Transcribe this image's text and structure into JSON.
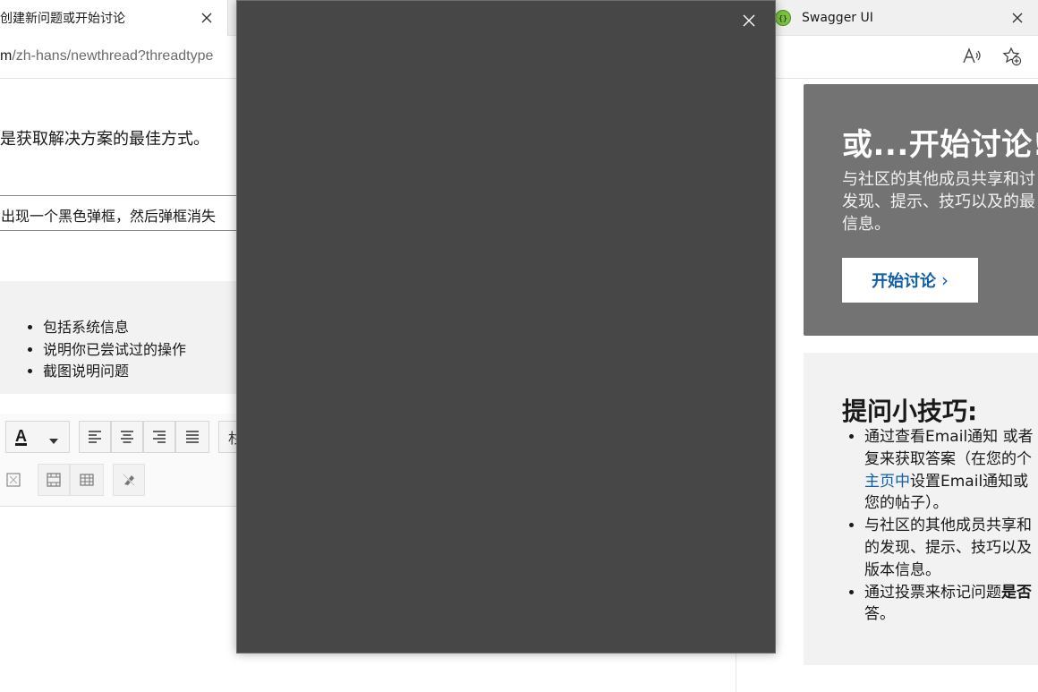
{
  "browser": {
    "active_tab_title": "创建新问题或开始讨论",
    "other_tab_title": "Swagger UI",
    "url_host": "m",
    "url_path": "/zh-hans/newthread?threadtype"
  },
  "page": {
    "intro_text": "是获取解决方案的最佳方式。",
    "title_input_value": "出现一个黑色弹框，然后弹框消失",
    "tips": [
      "包括系统信息",
      "说明你已尝试过的操作",
      "截图说明问题"
    ],
    "style_button_label": "杉"
  },
  "sidebar": {
    "discussion": {
      "title": "或...开始讨论!",
      "body_lines": [
        "与社区的其他成员共享和讨",
        "发现、提示、技巧以及的最",
        "信息。"
      ],
      "button_label": "开始讨论",
      "button_chevron": "›"
    },
    "tips_card": {
      "title": "提问小技巧:",
      "item1_lines": [
        "通过查看Email通知 或者",
        "复来获取答案（在您的个"
      ],
      "item1_link": "主页中",
      "item1_after_link": "设置Email通知或",
      "item1_tail": "您的帖子）。",
      "item2_lines": [
        "与社区的其他成员共享和",
        "的发现、提示、技巧以及",
        "版本信息。"
      ],
      "item3_prefix": "通过投票来标记问题",
      "item3_bold": "是否",
      "item3_tail": "答。"
    }
  },
  "colors": {
    "modal_background": "#474747",
    "discussion_card": "#737373",
    "link_blue": "#0f5ea8",
    "tips_background": "#f2f2f2"
  }
}
